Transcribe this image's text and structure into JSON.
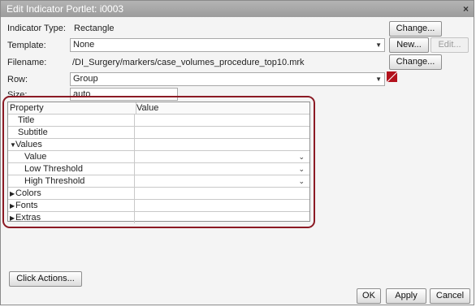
{
  "dialog": {
    "title": "Edit Indicator Portlet: i0003",
    "close_glyph": "×"
  },
  "indicator_type": {
    "label": "Indicator Type:",
    "value": "Rectangle",
    "change_label": "Change..."
  },
  "template": {
    "label": "Template:",
    "value": "None",
    "new_label": "New...",
    "edit_label": "Edit..."
  },
  "filename": {
    "label": "Filename:",
    "value": "/DI_Surgery/markers/case_volumes_procedure_top10.mrk",
    "change_label": "Change..."
  },
  "row": {
    "label": "Row:",
    "value": "Group",
    "swatch_color": "#b3121d"
  },
  "size": {
    "label": "Size:",
    "value": "auto"
  },
  "property_grid": {
    "col_property": "Property",
    "col_value": "Value",
    "rows": [
      {
        "label": "Title",
        "indent": 1,
        "expand": "",
        "dropdown": false
      },
      {
        "label": "Subtitle",
        "indent": 1,
        "expand": "",
        "dropdown": false
      },
      {
        "label": "Values",
        "indent": 0,
        "expand": "▼",
        "dropdown": false
      },
      {
        "label": "Value",
        "indent": 2,
        "expand": "",
        "dropdown": true
      },
      {
        "label": "Low Threshold",
        "indent": 2,
        "expand": "",
        "dropdown": true
      },
      {
        "label": "High Threshold",
        "indent": 2,
        "expand": "",
        "dropdown": true
      },
      {
        "label": "Colors",
        "indent": 0,
        "expand": "▶",
        "dropdown": false
      },
      {
        "label": "Fonts",
        "indent": 0,
        "expand": "▶",
        "dropdown": false
      },
      {
        "label": "Extras",
        "indent": 0,
        "expand": "▶",
        "dropdown": false
      }
    ],
    "dropdown_glyph": "⌄",
    "highlight_color": "#8b1a24"
  },
  "footer": {
    "click_actions_label": "Click Actions...",
    "ok_label": "OK",
    "apply_label": "Apply",
    "cancel_label": "Cancel"
  }
}
